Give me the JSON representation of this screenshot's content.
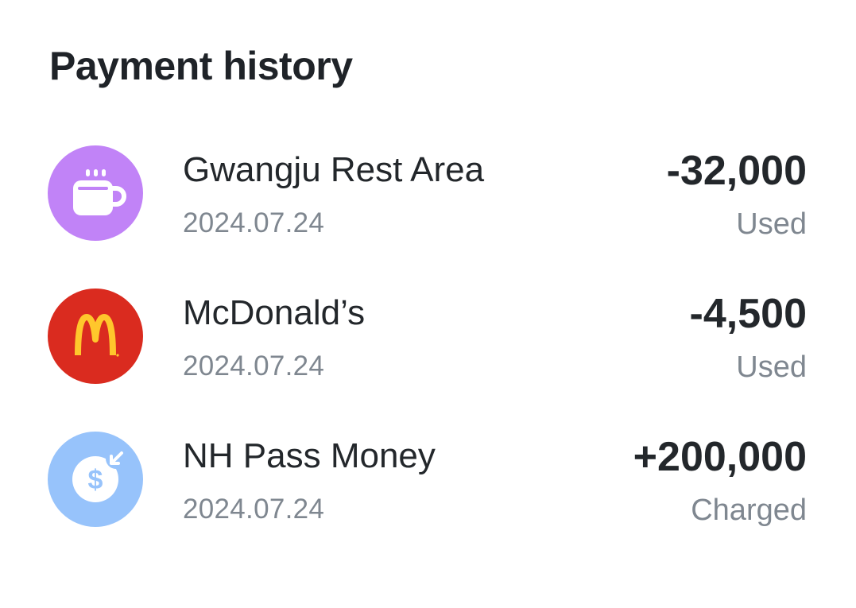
{
  "header": {
    "title": "Payment history"
  },
  "transactions": [
    {
      "merchant": "Gwangju Rest Area",
      "date": "2024.07.24",
      "amount": "-32,000",
      "status": "Used",
      "icon": "coffee-cup-icon",
      "icon_bg": "#c183f7"
    },
    {
      "merchant": "McDonald’s",
      "date": "2024.07.24",
      "amount": "-4,500",
      "status": "Used",
      "icon": "mcdonalds-logo-icon",
      "icon_bg": "#da2b1f"
    },
    {
      "merchant": "NH Pass Money",
      "date": "2024.07.24",
      "amount": "+200,000",
      "status": "Charged",
      "icon": "dollar-coin-icon",
      "icon_bg": "#97c3fb"
    }
  ]
}
